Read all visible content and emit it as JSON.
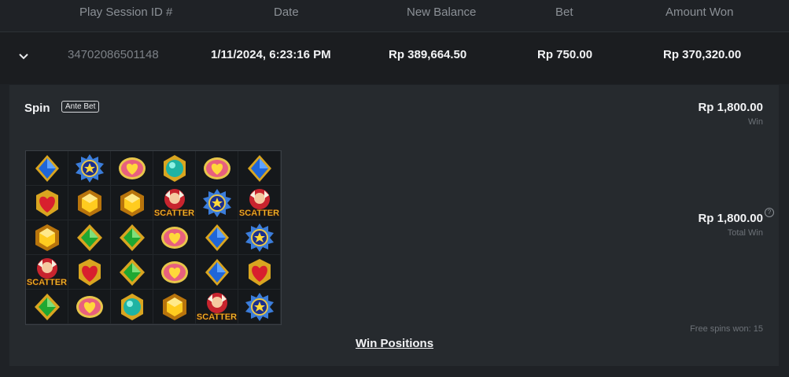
{
  "header": {
    "col_session": "Play Session ID #",
    "col_date": "Date",
    "col_balance": "New Balance",
    "col_bet": "Bet",
    "col_won": "Amount Won"
  },
  "row": {
    "session_id": "34702086501148",
    "date": "1/11/2024, 6:23:16 PM",
    "balance": "Rp 389,664.50",
    "bet": "Rp 750.00",
    "won": "Rp 370,320.00"
  },
  "detail": {
    "title": "Spin",
    "badge": "Ante Bet",
    "win_amount": "Rp 1,800.00",
    "win_label": "Win",
    "total_amount": "Rp 1,800.00",
    "total_label": "Total Win",
    "help_icon": "?",
    "free_spins": "Free spins won: 15",
    "win_positions": "Win Positions",
    "scatter_label": "SCATTER"
  },
  "grid": [
    [
      "blue-gem",
      "blue-star",
      "pink-heart",
      "teal-orb",
      "pink-heart",
      "blue-gem"
    ],
    [
      "red-heart",
      "gold-hex",
      "gold-hex",
      "scatter",
      "blue-star",
      "scatter"
    ],
    [
      "gold-hex",
      "green-gem",
      "green-gem",
      "pink-heart",
      "blue-gem",
      "blue-star"
    ],
    [
      "scatter",
      "red-heart",
      "green-gem",
      "pink-heart",
      "blue-gem",
      "red-heart"
    ],
    [
      "green-gem",
      "pink-heart",
      "teal-orb",
      "gold-hex",
      "scatter",
      "blue-star"
    ]
  ],
  "colors": {
    "background": "#1f2226",
    "panel": "#262a2e",
    "row": "#1b1d20"
  }
}
